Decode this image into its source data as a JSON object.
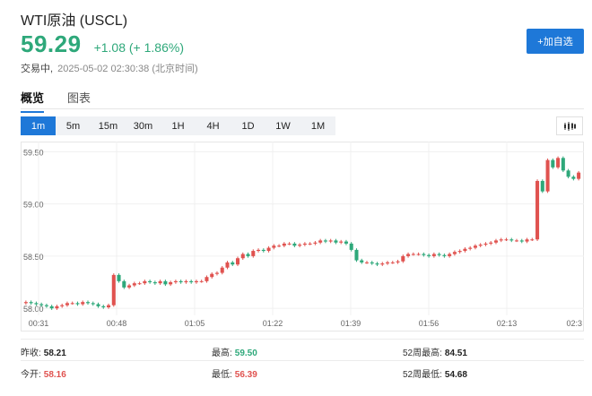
{
  "header": {
    "title": "WTI原油 (USCL)",
    "price": "59.29",
    "change": "+1.08 (+ 1.86%)",
    "status": "交易中,",
    "timestamp": "2025-05-02 02:30:38 (北京时间)",
    "add_button": "+加自选"
  },
  "tabs": [
    {
      "label": "概览",
      "active": true
    },
    {
      "label": "图表",
      "active": false
    }
  ],
  "intervals": [
    {
      "label": "1m",
      "active": true
    },
    {
      "label": "5m",
      "active": false
    },
    {
      "label": "15m",
      "active": false
    },
    {
      "label": "30m",
      "active": false
    },
    {
      "label": "1H",
      "active": false
    },
    {
      "label": "4H",
      "active": false
    },
    {
      "label": "1D",
      "active": false
    },
    {
      "label": "1W",
      "active": false
    },
    {
      "label": "1M",
      "active": false
    }
  ],
  "chart_type_icon": "candlestick-icon",
  "colors": {
    "up": "#e0524f",
    "down": "#2ea87a",
    "accent": "#1e78d8"
  },
  "chart_data": {
    "type": "candlestick",
    "y_ticks": [
      "59.50",
      "59.00",
      "58.50",
      "58.00"
    ],
    "x_ticks": [
      "00:31",
      "00:48",
      "01:05",
      "01:22",
      "01:39",
      "01:56",
      "02:13",
      "02:3"
    ],
    "ylim": [
      57.95,
      59.58
    ],
    "grid": true,
    "series_close": [
      58.06,
      58.05,
      58.04,
      58.03,
      58.02,
      58.0,
      58.02,
      58.03,
      58.05,
      58.05,
      58.04,
      58.06,
      58.05,
      58.04,
      58.02,
      58.01,
      58.03,
      58.32,
      58.26,
      58.2,
      58.22,
      58.24,
      58.24,
      58.26,
      58.25,
      58.24,
      58.26,
      58.23,
      58.25,
      58.26,
      58.25,
      58.26,
      58.25,
      58.26,
      58.26,
      58.3,
      58.33,
      58.34,
      58.39,
      58.44,
      58.42,
      58.48,
      58.52,
      58.5,
      58.55,
      58.56,
      58.55,
      58.58,
      58.6,
      58.6,
      58.62,
      58.62,
      58.6,
      58.61,
      58.62,
      58.62,
      58.63,
      58.65,
      58.64,
      58.65,
      58.63,
      58.64,
      58.62,
      58.56,
      58.46,
      58.44,
      58.44,
      58.43,
      58.42,
      58.43,
      58.44,
      58.44,
      58.45,
      58.5,
      58.52,
      58.52,
      58.52,
      58.51,
      58.5,
      58.52,
      58.51,
      58.5,
      58.52,
      58.54,
      58.55,
      58.57,
      58.58,
      58.6,
      58.61,
      58.62,
      58.63,
      58.65,
      58.66,
      58.66,
      58.65,
      58.65,
      58.64,
      58.66,
      58.66,
      59.22,
      59.12,
      59.42,
      59.35,
      59.44,
      59.32,
      59.26,
      59.24,
      59.3
    ],
    "labels": [
      "59.50",
      "59.00",
      "58.50",
      "58.00",
      "00:31",
      "00:48",
      "01:05",
      "01:22",
      "01:39",
      "01:56",
      "02:13",
      "02:3"
    ]
  },
  "stats": [
    [
      {
        "label": "昨收:",
        "value": "58.21",
        "tone": "neutral"
      },
      {
        "label": "最高:",
        "value": "59.50",
        "tone": "up"
      },
      {
        "label": "52周最高:",
        "value": "84.51",
        "tone": "neutral"
      }
    ],
    [
      {
        "label": "今开:",
        "value": "58.16",
        "tone": "down"
      },
      {
        "label": "最低:",
        "value": "56.39",
        "tone": "down"
      },
      {
        "label": "52周最低:",
        "value": "54.68",
        "tone": "neutral"
      }
    ]
  ]
}
